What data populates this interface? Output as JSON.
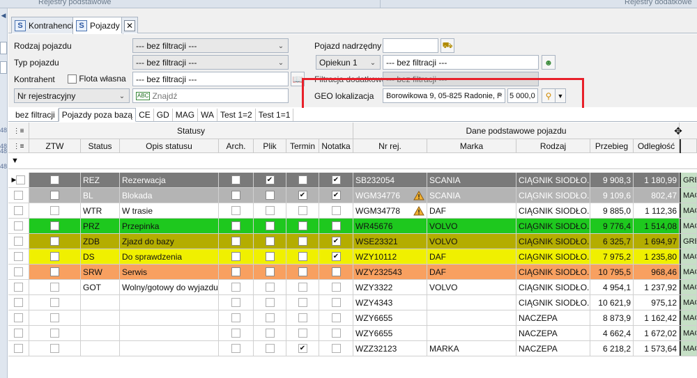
{
  "topstrip": {
    "left_label": "Rejestry podstawowe",
    "right_label": "Rejestry dodatkowe"
  },
  "leftstrip": {
    "nums": [
      "48",
      "48",
      "48",
      "48"
    ]
  },
  "tabs": [
    {
      "label": "Kontrahenci",
      "icon": "app-s-icon"
    },
    {
      "label": "Pojazdy",
      "icon": "app-s-icon"
    }
  ],
  "filters": {
    "rodzaj_label": "Rodzaj pojazdu",
    "rodzaj_value": "--- bez filtracji ---",
    "typ_label": "Typ pojazdu",
    "typ_value": "--- bez filtracji ---",
    "kontrahent_label": "Kontrahent",
    "flota_label": "Flota własna",
    "kontrahent_value": "--- bez filtracji ---",
    "nrrej_value": "Nr rejestracyjny",
    "znajdz_placeholder": "Znajdź",
    "nadrzedny_label": "Pojazd nadrzędny",
    "opiekun_value": "Opiekun 1",
    "opiekun_filter": "--- bez filtracji ---",
    "dodatkowa_label": "Filtracja dodatkowa",
    "dodatkowa_value": "--- bez filtracji ---",
    "geo_label": "GEO lokalizacja",
    "geo_value": "Borowikowa 9, 05-825 Radonie, P",
    "geo_radius": "5 000,0"
  },
  "quick_tabs": [
    "bez filtracji",
    "Pojazdy poza bazą",
    "CE",
    "GD",
    "MAG",
    "WA",
    "Test 1=2",
    "Test 1=1"
  ],
  "grid": {
    "band_statusy": "Statusy",
    "band_dane": "Dane podstawowe pojazdu",
    "headers": {
      "ztw": "ZTW",
      "status": "Status",
      "opis": "Opis statusu",
      "arch": "Arch.",
      "plik": "Plik",
      "termin": "Termin",
      "notatka": "Notatka",
      "nrrej": "Nr rej.",
      "marka": "Marka",
      "rodzaj": "Rodzaj",
      "przebieg": "Przebieg",
      "odleglosc": "Odległość"
    },
    "rows": [
      {
        "status": "REZ",
        "opis": "Rezerwacja",
        "plik": "✔",
        "termin": "",
        "notatka": "✔",
        "nrrej": "SB232054",
        "warn": false,
        "marka": "SCANIA",
        "rodzaj": "CIĄGNIK SIODŁO...",
        "przebieg": "9 908,3",
        "odleglosc": "1 180,99",
        "side": "GRE",
        "bg": "#7a7a7a",
        "fg": "#ffffff"
      },
      {
        "status": "BL",
        "opis": "Blokada",
        "plik": "",
        "termin": "✔",
        "notatka": "✔",
        "nrrej": "WGM34776",
        "warn": true,
        "marka": "SCANIA",
        "rodzaj": "CIĄGNIK SIODŁO...",
        "przebieg": "9 109,6",
        "odleglosc": "802,47",
        "side": "MAG",
        "bg": "#b4b4b4",
        "fg": "#ffffff"
      },
      {
        "status": "WTR",
        "opis": "W trasie",
        "plik": "",
        "termin": "",
        "notatka": "",
        "nrrej": "WGM34778",
        "warn": true,
        "marka": "DAF",
        "rodzaj": "CIĄGNIK SIODŁO...",
        "przebieg": "9 885,0",
        "odleglosc": "1 112,36",
        "side": "MAG",
        "bg": "#ffffff",
        "fg": "#111111"
      },
      {
        "status": "PRZ",
        "opis": "Przepinka",
        "plik": "",
        "termin": "",
        "notatka": "",
        "nrrej": "WR45676",
        "warn": false,
        "marka": "VOLVO",
        "rodzaj": "CIĄGNIK SIODŁO...",
        "przebieg": "9 776,4",
        "odleglosc": "1 514,08",
        "side": "MAG",
        "bg": "#1ec81e",
        "fg": "#111111"
      },
      {
        "status": "ZDB",
        "opis": "Zjazd do bazy",
        "plik": "",
        "termin": "",
        "notatka": "✔",
        "nrrej": "WSE23321",
        "warn": false,
        "marka": "VOLVO",
        "rodzaj": "CIĄGNIK SIODŁO...",
        "przebieg": "6 325,7",
        "odleglosc": "1 694,97",
        "side": "GRE",
        "bg": "#b4ad00",
        "fg": "#111111"
      },
      {
        "status": "DS",
        "opis": "Do sprawdzenia",
        "plik": "",
        "termin": "",
        "notatka": "✔",
        "nrrej": "WZY10112",
        "warn": false,
        "marka": "DAF",
        "rodzaj": "CIĄGNIK SIODŁO...",
        "przebieg": "7 975,2",
        "odleglosc": "1 235,80",
        "side": "MAG",
        "bg": "#f0f000",
        "fg": "#111111"
      },
      {
        "status": "SRW",
        "opis": "Serwis",
        "plik": "",
        "termin": "",
        "notatka": "",
        "nrrej": "WZY232543",
        "warn": false,
        "marka": "DAF",
        "rodzaj": "CIĄGNIK SIODŁO...",
        "przebieg": "10 795,5",
        "odleglosc": "968,46",
        "side": "MAG",
        "bg": "#f8a060",
        "fg": "#111111"
      },
      {
        "status": "GOT",
        "opis": "Wolny/gotowy do wyjazdu",
        "plik": "",
        "termin": "",
        "notatka": "",
        "nrrej": "WZY3322",
        "warn": false,
        "marka": "VOLVO",
        "rodzaj": "CIĄGNIK SIODŁO...",
        "przebieg": "4 954,1",
        "odleglosc": "1 237,92",
        "side": "MAG",
        "bg": "#ffffff",
        "fg": "#111111"
      },
      {
        "status": "",
        "opis": "",
        "plik": "",
        "termin": "",
        "notatka": "",
        "nrrej": "WZY4343",
        "warn": false,
        "marka": "",
        "rodzaj": "CIĄGNIK SIODŁO...",
        "przebieg": "10 621,9",
        "odleglosc": "975,12",
        "side": "MAG",
        "bg": "#ffffff",
        "fg": "#111111"
      },
      {
        "status": "",
        "opis": "",
        "plik": "",
        "termin": "",
        "notatka": "",
        "nrrej": "WZY6655",
        "warn": false,
        "marka": "",
        "rodzaj": "NACZEPA",
        "przebieg": "8 873,9",
        "odleglosc": "1 162,42",
        "side": "MAG",
        "bg": "#ffffff",
        "fg": "#111111"
      },
      {
        "status": "",
        "opis": "",
        "plik": "",
        "termin": "",
        "notatka": "",
        "nrrej": "WZY6655",
        "warn": false,
        "marka": "",
        "rodzaj": "NACZEPA",
        "przebieg": "4 662,4",
        "odleglosc": "1 672,02",
        "side": "MAG",
        "bg": "#ffffff",
        "fg": "#111111"
      },
      {
        "status": "",
        "opis": "",
        "plik": "",
        "termin": "✔",
        "notatka": "",
        "nrrej": "WZZ32123",
        "warn": false,
        "marka": "MARKA",
        "rodzaj": "NACZEPA",
        "przebieg": "6 218,2",
        "odleglosc": "1 573,64",
        "side": "MAG",
        "bg": "#ffffff",
        "fg": "#111111"
      }
    ]
  },
  "colors": {
    "highlight_frame": "#e8202a",
    "side_column": "#c6e0c6"
  }
}
